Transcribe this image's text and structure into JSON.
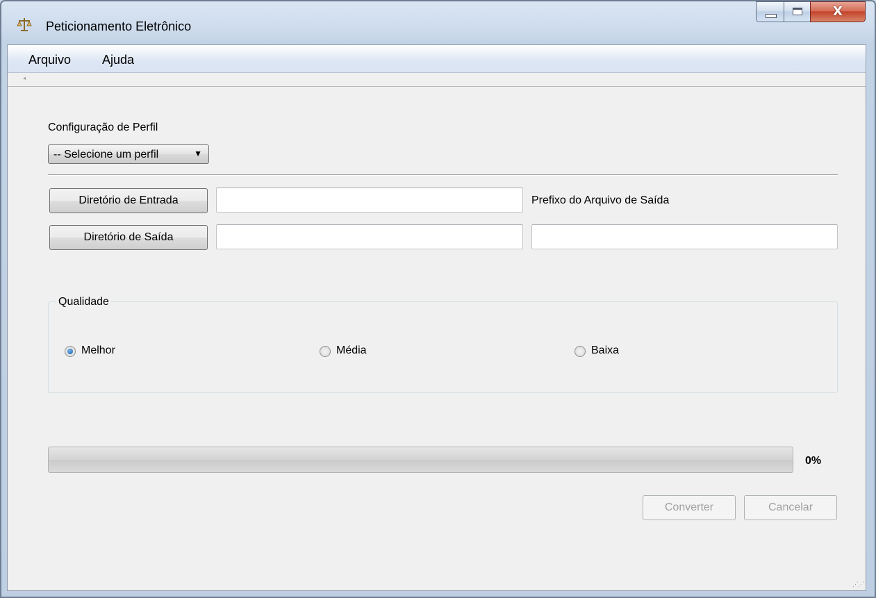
{
  "window": {
    "title": "Peticionamento Eletrônico",
    "icon": "scales-icon",
    "close_glyph": "X"
  },
  "menu": {
    "items": [
      "Arquivo",
      "Ajuda"
    ]
  },
  "profile": {
    "label": "Configuração de Perfil",
    "selected": "-- Selecione um perfil"
  },
  "directories": {
    "input_button": "Diretório de Entrada",
    "output_button": "Diretório de Saída",
    "input_value": "",
    "output_value": "",
    "prefix_label": "Prefixo do Arquivo de Saída",
    "prefix_value": ""
  },
  "quality": {
    "title": "Qualidade",
    "options": [
      {
        "label": "Melhor",
        "checked": true
      },
      {
        "label": "Média",
        "checked": false
      },
      {
        "label": "Baixa",
        "checked": false
      }
    ]
  },
  "progress": {
    "value": 0,
    "text": "0%"
  },
  "actions": {
    "convert": "Converter",
    "cancel": "Cancelar",
    "disabled": true
  },
  "colors": {
    "accent": "#1a5fa8",
    "window_frame": "#c3d3e6",
    "close_button": "#c4432b"
  }
}
